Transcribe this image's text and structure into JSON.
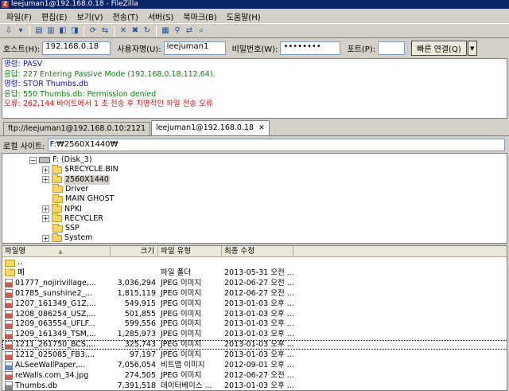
{
  "window": {
    "title": "leejuman1@192.168.0.18 - FileZilla",
    "app_icon_letter": "Z"
  },
  "menu": [
    {
      "label": "파일(F)"
    },
    {
      "label": "편집(E)"
    },
    {
      "label": "보기(V)"
    },
    {
      "label": "전송(T)"
    },
    {
      "label": "서버(S)"
    },
    {
      "label": "북마크(B)"
    },
    {
      "label": "도움말(H)"
    }
  ],
  "toolbar": {
    "icons": [
      "site-manager-icon",
      "dropdown-arrow-icon",
      "toggle-log-icon",
      "toggle-tree-icon",
      "toggle-local-icon",
      "toggle-remote-icon",
      "refresh-icon",
      "process-queue-icon",
      "cancel-icon",
      "disconnect-icon",
      "reconnect-icon",
      "filter-icon",
      "compare-icon",
      "sync-browse-icon",
      "search-icon"
    ],
    "glyphs": [
      "⇩",
      "▾",
      "▤",
      "▥",
      "◧",
      "◨",
      "⟳",
      "⇆",
      "✕",
      "✖",
      "↻",
      "▦",
      "⚲",
      "⇄",
      "⌕"
    ]
  },
  "quickconnect": {
    "host_label": "호스트(H):",
    "host_value": "192.168.0.18",
    "user_label": "사용자명(U):",
    "user_value": "leejuman1",
    "pass_label": "비밀번호(W):",
    "pass_value": "••••••••",
    "port_label": "포트(P):",
    "port_value": "",
    "connect_label": "빠른 연결(Q)",
    "dropdown_glyph": "▼"
  },
  "log": [
    {
      "tag": "명령:",
      "text": "PASV",
      "color": "#1010c0"
    },
    {
      "tag": "응답:",
      "text": "227 Entering Passive Mode (192,168,0,18,112,64).",
      "color": "#108010"
    },
    {
      "tag": "명령:",
      "text": "STOR Thumbs.db",
      "color": "#1010c0"
    },
    {
      "tag": "응답:",
      "text": "550 Thumbs.db: Permission denied",
      "color": "#108010"
    },
    {
      "tag": "오류:",
      "text": "262,144 바이트에서 1 초 전송 후 치명적인 파일 전송 오류",
      "color": "#e01010"
    }
  ],
  "tabs": [
    {
      "label": "ftp://leejuman1@192.168.0.10:2121",
      "active": false
    },
    {
      "label": "leejuman1@192.168.0.18",
      "active": true,
      "close": "✕"
    }
  ],
  "local_site": {
    "label": "로컬 사이트:",
    "path": "F:₩2560X1440₩"
  },
  "tree": [
    {
      "label": "F: (Disk_3)",
      "type": "drive",
      "expander": "−"
    },
    {
      "label": "$RECYCLE.BIN",
      "type": "folder",
      "expander": "+"
    },
    {
      "label": "2560X1440",
      "type": "folder",
      "expander": "+",
      "selected": true
    },
    {
      "label": "Driver",
      "type": "folder",
      "expander": ""
    },
    {
      "label": "MAIN GHOST",
      "type": "folder",
      "expander": ""
    },
    {
      "label": "NPKI",
      "type": "folder",
      "expander": "+"
    },
    {
      "label": "RECYCLER",
      "type": "folder",
      "expander": "+"
    },
    {
      "label": "SSP",
      "type": "folder",
      "expander": ""
    },
    {
      "label": "System",
      "type": "folder",
      "expander": "+"
    }
  ],
  "file_columns": {
    "name": "파일명",
    "sort_glyph": "▲",
    "size": "크기",
    "type": "파일 유형",
    "modified": "최종 수정"
  },
  "files": [
    {
      "name": "..",
      "size": "",
      "type": "",
      "date": "",
      "icon": "up"
    },
    {
      "name": "폐",
      "size": "",
      "type": "파일 폴더",
      "date": "2013-05-31 오전 ...",
      "icon": "folder"
    },
    {
      "name": "01777_nojirivillage,...",
      "size": "3,036,294",
      "type": "JPEG 이미지",
      "date": "2012-06-27 오전 ...",
      "icon": "jpeg"
    },
    {
      "name": "01785_sunshine2_...",
      "size": "1,815,119",
      "type": "JPEG 이미지",
      "date": "2012-06-27 오전 ...",
      "icon": "jpeg"
    },
    {
      "name": "1207_161349_G1Z,...",
      "size": "549,915",
      "type": "JPEG 이미지",
      "date": "2013-01-03 오후 ...",
      "icon": "jpeg"
    },
    {
      "name": "1208_086254_USZ,...",
      "size": "501,855",
      "type": "JPEG 이미지",
      "date": "2013-01-03 오후 ...",
      "icon": "jpeg"
    },
    {
      "name": "1209_063554_UFLF...",
      "size": "599,556",
      "type": "JPEG 이미지",
      "date": "2013-01-03 오후 ...",
      "icon": "jpeg"
    },
    {
      "name": "1209_161349_TSM,...",
      "size": "1,285,973",
      "type": "JPEG 이미지",
      "date": "2013-01-03 오후 ...",
      "icon": "jpeg"
    },
    {
      "name": "1211_261750_BCS,...",
      "size": "325,743",
      "type": "JPEG 이미지",
      "date": "2013-01-03 오후 ...",
      "icon": "jpeg",
      "focused": true
    },
    {
      "name": "1212_025085_FB3,...",
      "size": "97,197",
      "type": "JPEG 이미지",
      "date": "2013-01-03 오후 ...",
      "icon": "jpeg"
    },
    {
      "name": "ALSeeWallPaper,...",
      "size": "7,056,054",
      "type": "비트맵 이미지",
      "date": "2012-09-01 오후 ...",
      "icon": "bmp"
    },
    {
      "name": "reWalls.com_34.jpg",
      "size": "274,505",
      "type": "JPEG 이미지",
      "date": "2012-06-27 오전 ...",
      "icon": "jpeg"
    },
    {
      "name": "Thumbs.db",
      "size": "7,391,518",
      "type": "데이터베이스 ...",
      "date": "2013-01-03 오후 ...",
      "icon": "db"
    }
  ]
}
